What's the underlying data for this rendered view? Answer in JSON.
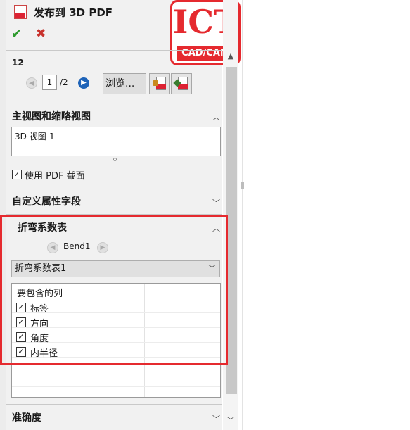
{
  "title": "发布到 3D PDF",
  "logo": {
    "main": "ICT",
    "sub": "CAD/CAM"
  },
  "pages": {
    "count_label": "12",
    "current": "1",
    "total": "/2",
    "browse_label": "浏览..."
  },
  "sections": {
    "main_view": {
      "title": "主视图和缩略视图",
      "view_text": "3D 视图-1",
      "use_pdf_section_label": "使用 PDF 截面",
      "use_pdf_section_checked": true
    },
    "custom_props": {
      "title": "自定义属性字段"
    },
    "bend_table": {
      "title": "折弯系数表",
      "bend_label": "Bend1",
      "selected_table": "折弯系数表1",
      "columns_header": "要包含的列",
      "columns": [
        {
          "label": "标签",
          "checked": true
        },
        {
          "label": "方向",
          "checked": true
        },
        {
          "label": "角度",
          "checked": true
        },
        {
          "label": "内半径",
          "checked": true
        }
      ]
    },
    "accuracy": {
      "title": "准确度"
    }
  },
  "colors": {
    "accent_red": "#e52a2f",
    "ok_green": "#2c9a2c",
    "cancel_red": "#c8322d",
    "nav_blue": "#1e63b8"
  }
}
